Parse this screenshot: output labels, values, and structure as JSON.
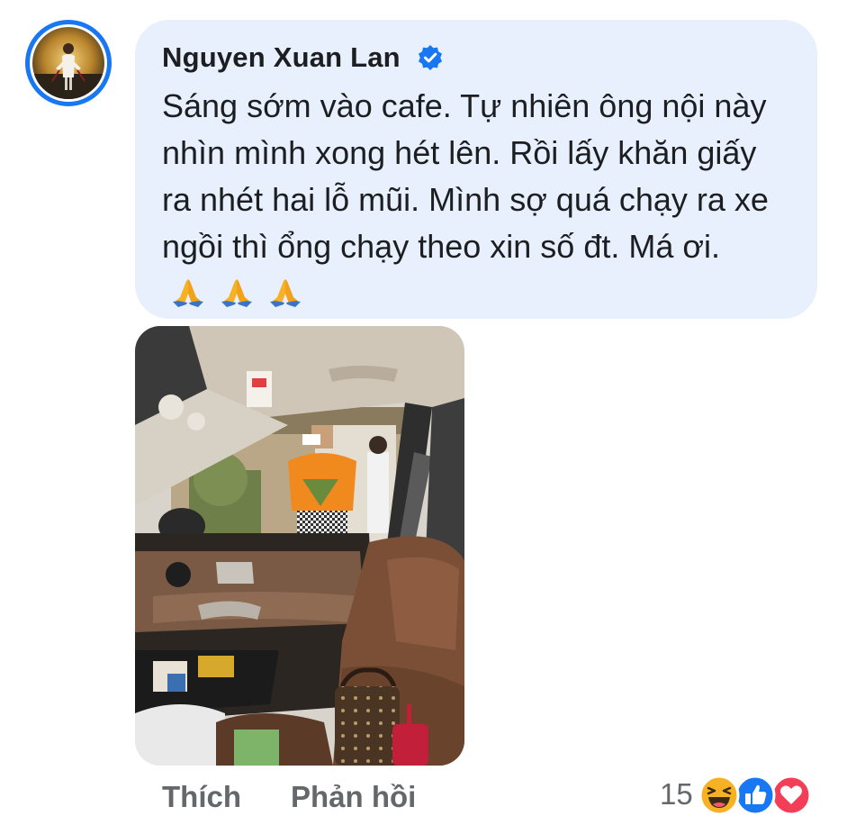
{
  "comment": {
    "author": "Nguyen Xuan Lan",
    "verified": true,
    "text": "Sáng sớm vào cafe. Tự nhiên ông nội này nhìn mình xong hét lên. Rồi lấy khăn giấy ra nhét hai lỗ mũi. Mình sợ quá chạy ra xe ngồi thì ổng chạy theo xin số đt. Má ơi.",
    "emoji": [
      "folded-hands",
      "folded-hands",
      "folded-hands"
    ]
  },
  "actions": {
    "like_label": "Thích",
    "reply_label": "Phản hồi"
  },
  "reactions": {
    "count": "15",
    "types": [
      "haha",
      "like",
      "love"
    ]
  },
  "colors": {
    "accent": "#1877f2",
    "bubble": "#e8f0fd",
    "secondary_text": "#65676b",
    "love": "#f33e58",
    "haha": "#f7b125"
  }
}
